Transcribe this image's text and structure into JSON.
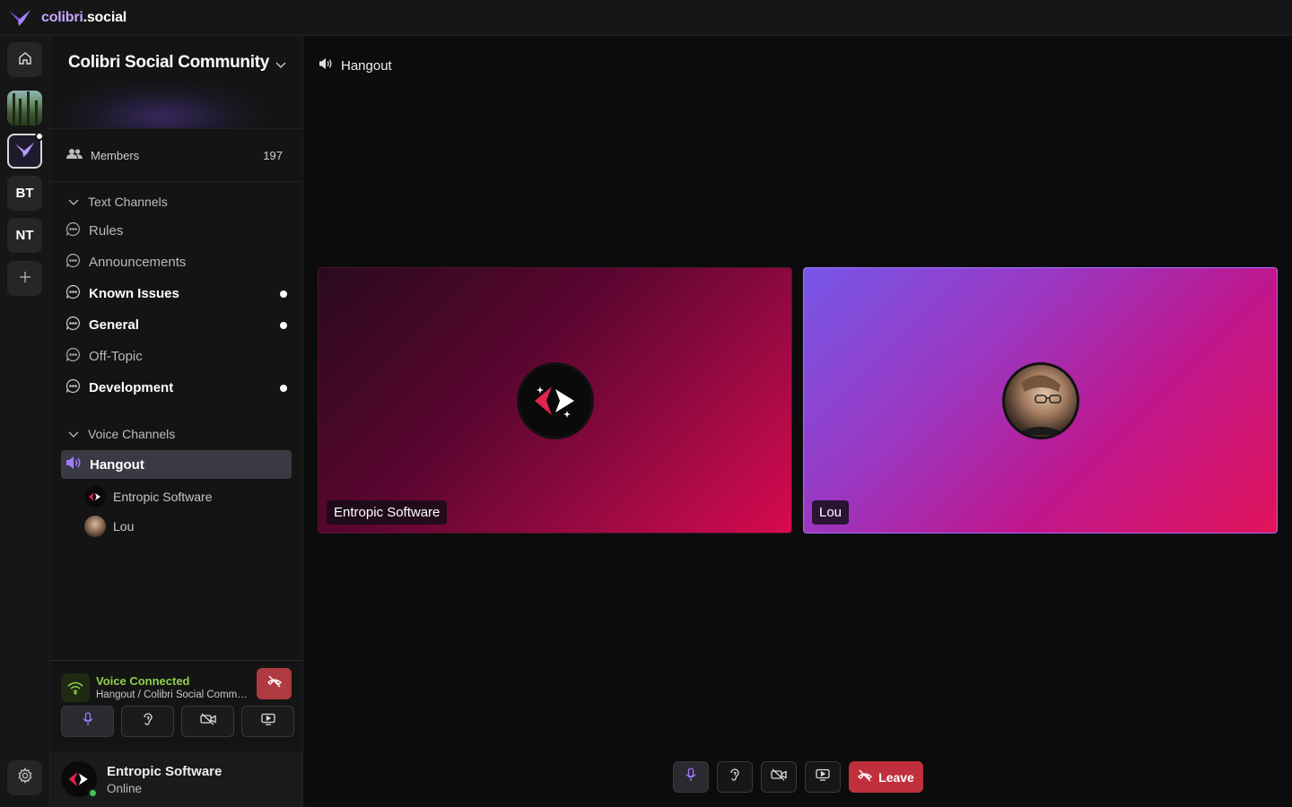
{
  "app": {
    "brand_name": "colibri",
    "brand_suffix": ".social"
  },
  "rail": {
    "items": [
      {
        "type": "icon",
        "icon": "home-icon"
      },
      {
        "type": "image",
        "icon": "forest-server-avatar"
      },
      {
        "type": "image",
        "icon": "colibri-server-avatar",
        "active": true,
        "notification": true
      },
      {
        "type": "text",
        "label": "BT"
      },
      {
        "type": "text",
        "label": "NT"
      },
      {
        "type": "icon",
        "icon": "plus-icon"
      }
    ],
    "settings_icon": "gear-icon"
  },
  "sidebar": {
    "server_name": "Colibri Social Community",
    "members_label": "Members",
    "members_count": "197",
    "text_category": "Text Channels",
    "text_channels": [
      {
        "label": "Rules",
        "unread": false
      },
      {
        "label": "Announcements",
        "unread": false
      },
      {
        "label": "Known Issues",
        "unread": true
      },
      {
        "label": "General",
        "unread": true
      },
      {
        "label": "Off-Topic",
        "unread": false
      },
      {
        "label": "Development",
        "unread": true
      }
    ],
    "voice_category": "Voice Channels",
    "voice_channel": "Hangout",
    "voice_users": [
      {
        "name": "Entropic Software"
      },
      {
        "name": "Lou"
      }
    ]
  },
  "voice_panel": {
    "title": "Voice Connected",
    "subtitle": "Hangout / Colibri Social Community"
  },
  "user": {
    "name": "Entropic Software",
    "status": "Online",
    "status_color": "#3fc35b"
  },
  "main": {
    "channel_title": "Hangout",
    "tiles": [
      {
        "name": "Entropic Software"
      },
      {
        "name": "Lou"
      }
    ],
    "leave_label": "Leave"
  },
  "colors": {
    "accent": "#c9a7ff",
    "voice_connected": "#8fd14f",
    "danger": "#c0303c",
    "mic_active": "#a07cff"
  }
}
